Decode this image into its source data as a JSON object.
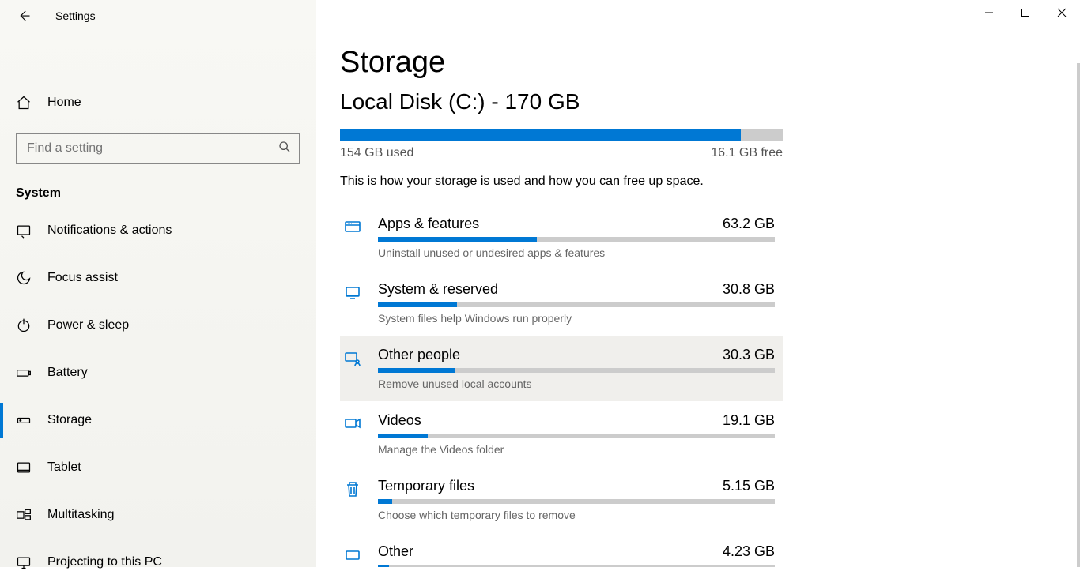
{
  "app_title": "Settings",
  "home_label": "Home",
  "search_placeholder": "Find a setting",
  "section_label": "System",
  "nav_items": [
    {
      "key": "notifications",
      "label": "Notifications & actions"
    },
    {
      "key": "focus-assist",
      "label": "Focus assist"
    },
    {
      "key": "power-sleep",
      "label": "Power & sleep"
    },
    {
      "key": "battery",
      "label": "Battery"
    },
    {
      "key": "storage",
      "label": "Storage"
    },
    {
      "key": "tablet",
      "label": "Tablet"
    },
    {
      "key": "multitasking",
      "label": "Multitasking"
    },
    {
      "key": "projecting",
      "label": "Projecting to this PC"
    }
  ],
  "selected_nav": "storage",
  "page_title": "Storage",
  "disk": {
    "title": "Local Disk (C:) - 170 GB",
    "used_label": "154 GB used",
    "free_label": "16.1 GB free",
    "fill_percent": 90.5
  },
  "description": "This is how your storage is used and how you can free up space.",
  "categories": [
    {
      "key": "apps",
      "name": "Apps & features",
      "size": "63.2 GB",
      "hint": "Uninstall unused or undesired apps & features",
      "percent": 40
    },
    {
      "key": "system",
      "name": "System & reserved",
      "size": "30.8 GB",
      "hint": "System files help Windows run properly",
      "percent": 20
    },
    {
      "key": "other-people",
      "name": "Other people",
      "size": "30.3 GB",
      "hint": "Remove unused local accounts",
      "percent": 19.5,
      "hover": true
    },
    {
      "key": "videos",
      "name": "Videos",
      "size": "19.1 GB",
      "hint": "Manage the Videos folder",
      "percent": 12.5
    },
    {
      "key": "temp",
      "name": "Temporary files",
      "size": "5.15 GB",
      "hint": "Choose which temporary files to remove",
      "percent": 3.5
    },
    {
      "key": "other",
      "name": "Other",
      "size": "4.23 GB",
      "hint": "",
      "percent": 2.8
    }
  ]
}
